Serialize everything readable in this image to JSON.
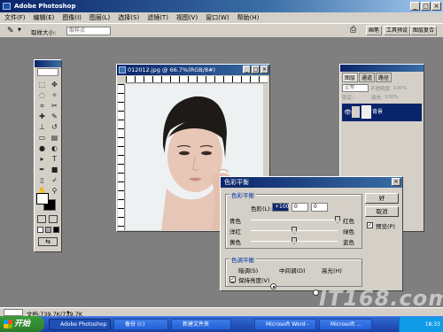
{
  "app": {
    "title": "Adobe Photoshop"
  },
  "window_buttons": [
    "_",
    "□",
    "×"
  ],
  "menu": [
    "文件(F)",
    "编辑(E)",
    "图像(I)",
    "图层(L)",
    "选择(S)",
    "滤镜(T)",
    "视图(V)",
    "窗口(W)",
    "帮助(H)"
  ],
  "options": {
    "label": "取样大小:",
    "value": "取样点",
    "palettes": [
      "画笔",
      "工具预设",
      "图层复合"
    ]
  },
  "document": {
    "title": "012012.jpg @ 66.7%(RGB/8#)"
  },
  "layers": {
    "tabs": [
      "图层",
      "通道",
      "路径"
    ],
    "blend_mode": "正常",
    "opacity_label": "不透明度:",
    "opacity": "100%",
    "fill_label": "填充:",
    "fill": "100%",
    "lock_label": "锁定:",
    "layer_name": "背景"
  },
  "dialog": {
    "title": "色彩平衡",
    "balance_group": "色彩平衡",
    "levels_label": "色阶(L):",
    "levels": [
      "+100",
      "0",
      "0"
    ],
    "sliders": [
      {
        "left": "青色",
        "right": "红色",
        "position": 1.0
      },
      {
        "left": "洋红",
        "right": "绿色",
        "position": 0.5
      },
      {
        "left": "黄色",
        "right": "蓝色",
        "position": 0.5
      }
    ],
    "tone_group": "色调平衡",
    "tones": [
      "暗调(S)",
      "中间调(D)",
      "高光(H)"
    ],
    "tone_selected": 1,
    "preserve_label": "保持亮度(V)",
    "ok": "好",
    "cancel": "取消",
    "preview": "预览(P)"
  },
  "status": {
    "text": "文档:739.7K/739.7K"
  },
  "taskbar": {
    "start": "开始",
    "tasks": [
      "Adobe Photoshop",
      "备份 (I:)",
      "新建文件夹",
      "Microsoft Word -",
      "Microsoft ..."
    ],
    "time": "18:33"
  },
  "watermark": "IT168.com"
}
